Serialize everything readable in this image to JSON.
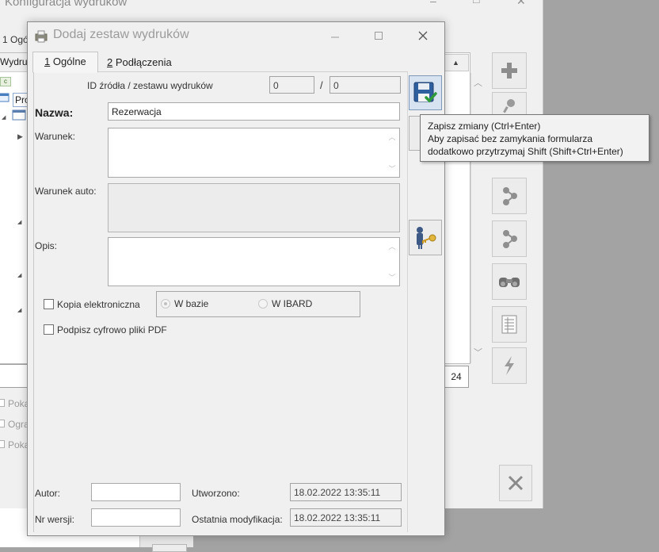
{
  "background_window": {
    "title": "Konfiguracja wydruków",
    "tab_label": "1 Ogó",
    "grid_column_header": "Wydru",
    "grid_item_partial": "Pro",
    "count_value": "24",
    "check_labels": [
      "Poka",
      "Ogra",
      "Poka"
    ]
  },
  "dialog": {
    "title": "Dodaj zestaw wydruków",
    "tabs": [
      {
        "num": "1",
        "label": "Ogólne"
      },
      {
        "num": "2",
        "label": "Podłączenia"
      }
    ],
    "id_label": "ID źródła / zestawu wydruków",
    "id_source_value": "0",
    "id_separator": "/",
    "id_set_value": "0",
    "name_label": "Nazwa:",
    "name_value": "Rezerwacja",
    "condition_label": "Warunek:",
    "condition_value": "",
    "auto_condition_label": "Warunek auto:",
    "description_label": "Opis:",
    "description_value": "",
    "electronic_copy_label": "Kopia elektroniczna",
    "radio_in_db": "W bazie",
    "radio_ibard": "W IBARD",
    "sign_pdf_label": "Podpisz cyfrowo pliki PDF",
    "author_label": "Autor:",
    "author_value": "",
    "created_label": "Utworzono:",
    "created_value": "18.02.2022 13:35:11",
    "version_label": "Nr wersji:",
    "version_value": "",
    "modified_label": "Ostatnia modyfikacja:",
    "modified_value": "18.02.2022 13:35:11"
  },
  "tooltip": {
    "line1": "Zapisz zmiany (Ctrl+Enter)",
    "line2": "Aby zapisać bez zamykania formularza",
    "line3": "dodatkowo przytrzymaj Shift (Shift+Ctrl+Enter)"
  },
  "icons": {
    "save": "floppy-save-icon",
    "user_key": "user-key-icon",
    "add": "plus-icon",
    "binoculars": "binoculars-icon",
    "close": "close-icon"
  },
  "colors": {
    "window_bg": "#f0f0f0",
    "outer_bg": "#a3a3a3",
    "save_button_bg": "#d7e3f0",
    "text": "#1e1e1e"
  }
}
